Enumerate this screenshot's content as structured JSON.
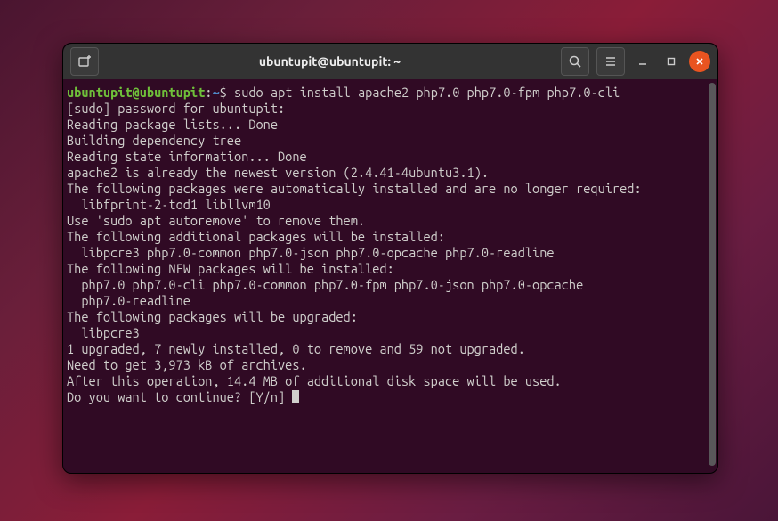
{
  "window": {
    "title": "ubuntupit@ubuntupit: ~"
  },
  "prompt": {
    "user_host": "ubuntupit@ubuntupit",
    "separator": ":",
    "path": "~",
    "symbol": "$"
  },
  "command": "sudo apt install apache2 php7.0 php7.0-fpm php7.0-cli",
  "output_lines": [
    "[sudo] password for ubuntupit:",
    "Reading package lists... Done",
    "Building dependency tree",
    "Reading state information... Done",
    "apache2 is already the newest version (2.4.41-4ubuntu3.1).",
    "The following packages were automatically installed and are no longer required:",
    "  libfprint-2-tod1 libllvm10",
    "Use 'sudo apt autoremove' to remove them.",
    "The following additional packages will be installed:",
    "  libpcre3 php7.0-common php7.0-json php7.0-opcache php7.0-readline",
    "The following NEW packages will be installed:",
    "  php7.0 php7.0-cli php7.0-common php7.0-fpm php7.0-json php7.0-opcache",
    "  php7.0-readline",
    "The following packages will be upgraded:",
    "  libpcre3",
    "1 upgraded, 7 newly installed, 0 to remove and 59 not upgraded.",
    "Need to get 3,973 kB of archives.",
    "After this operation, 14.4 MB of additional disk space will be used.",
    "Do you want to continue? [Y/n] "
  ],
  "colors": {
    "desktop_bg": "#5a1a3a",
    "terminal_bg": "#300a24",
    "text": "#d0cfcc",
    "prompt_user": "#6fbf3a",
    "prompt_path": "#4e8ac8",
    "close_btn": "#e95420"
  },
  "icons": {
    "new_tab": "new-tab-icon",
    "search": "search-icon",
    "menu": "menu-icon",
    "minimize": "minimize-icon",
    "maximize": "maximize-icon",
    "close": "close-icon"
  }
}
